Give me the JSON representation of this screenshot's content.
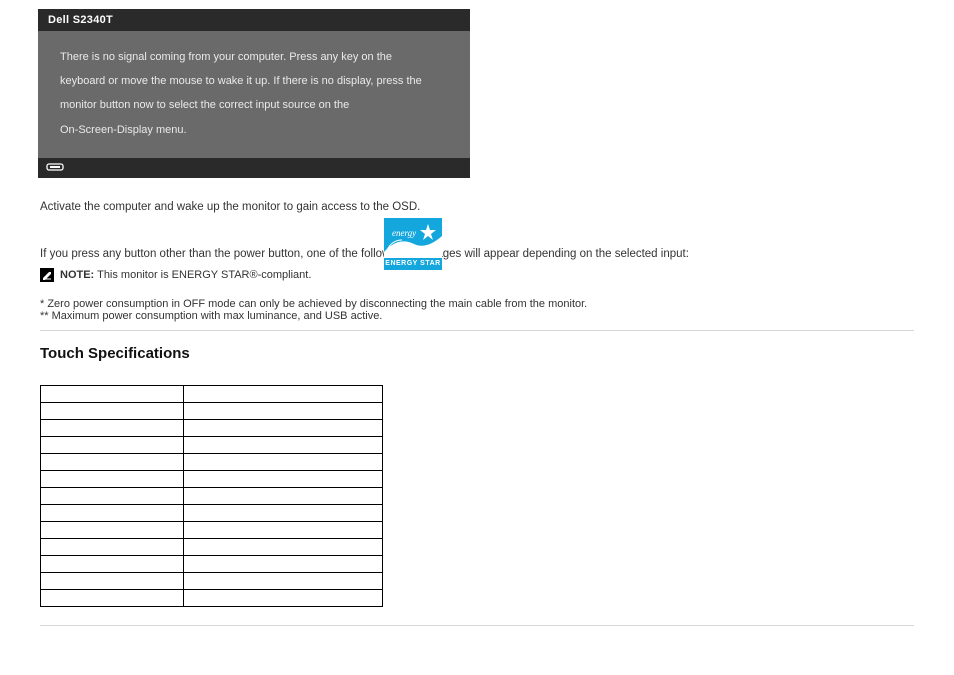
{
  "osd": {
    "title": "Dell S2340T",
    "line1": "There is no signal coming from your computer. Press any key on the",
    "line2": "keyboard or move the mouse to wake it up. If there is no display, press the",
    "line3": "monitor button now to select the correct input source on the",
    "line4": "On-Screen-Display menu."
  },
  "pm_text": "Activate the computer and wake up the monitor to gain access to the OSD.",
  "es_lead": "If you press any button other than the power button, one of the following messages will appear depending on the selected input:",
  "es_logo_label": "ENERGY STAR",
  "note": {
    "label": "NOTE:",
    "text": "This monitor is ENERGY STAR®-compliant."
  },
  "caveat": "* Zero power consumption in OFF mode can only be achieved by disconnecting the main cable from the monitor.",
  "caveat2": "** Maximum power consumption with max luminance, and USB active.",
  "section_heading": "Touch Specifications",
  "section_sub": "",
  "pin_table": {
    "headers": [
      "",
      ""
    ],
    "rows": [
      [
        "",
        ""
      ],
      [
        "",
        ""
      ],
      [
        "",
        ""
      ],
      [
        "",
        ""
      ],
      [
        "",
        ""
      ],
      [
        "",
        ""
      ],
      [
        "",
        ""
      ],
      [
        "",
        ""
      ],
      [
        "",
        ""
      ],
      [
        "",
        ""
      ],
      [
        "",
        ""
      ],
      [
        "",
        ""
      ]
    ]
  }
}
